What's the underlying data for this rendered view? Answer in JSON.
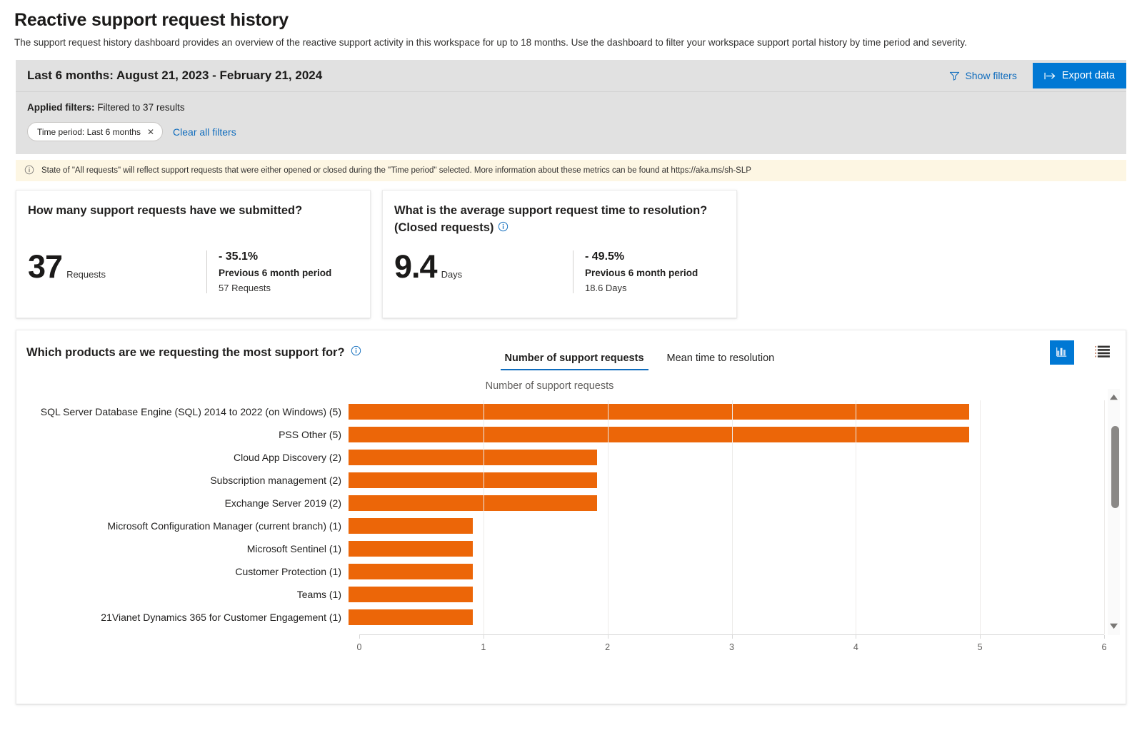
{
  "header": {
    "title": "Reactive support request history",
    "description": "The support request history dashboard provides an overview of the reactive support activity in this workspace for up to 18 months. Use the dashboard to filter your workspace support portal history by time period and severity."
  },
  "filters": {
    "range_label": "Last 6 months: August 21, 2023 - February 21, 2024",
    "show_filters_label": "Show filters",
    "export_label": "Export data",
    "applied_label": "Applied filters:",
    "applied_summary": "Filtered to 37 results",
    "chips": [
      {
        "label": "Time period: Last 6 months",
        "close": "✕"
      }
    ],
    "clear_all_label": "Clear all filters"
  },
  "banner": {
    "text": "State of \"All requests\" will reflect support requests that were either opened or closed during the \"Time period\" selected. More information about these metrics can be found at https://aka.ms/sh-SLP"
  },
  "kpis": [
    {
      "question": "How many support requests have we submitted?",
      "question_sub": "",
      "has_info": false,
      "value": "37",
      "unit": "Requests",
      "delta": "- 35.1%",
      "previous_label": "Previous 6 month period",
      "previous_value": "57 Requests"
    },
    {
      "question": "What is the average support request time to resolution?",
      "question_sub": "(Closed requests)",
      "has_info": true,
      "value": "9.4",
      "unit": "Days",
      "delta": "- 49.5%",
      "previous_label": "Previous 6 month period",
      "previous_value": "18.6 Days"
    }
  ],
  "chart_panel": {
    "question": "Which products are we requesting the most support for?",
    "tabs": [
      {
        "label": "Number of support requests",
        "active": true
      },
      {
        "label": "Mean time to resolution",
        "active": false
      }
    ],
    "view_buttons": [
      {
        "icon": "bar-chart-icon",
        "active": true
      },
      {
        "icon": "details-list-icon",
        "active": false
      }
    ]
  },
  "chart_data": {
    "type": "bar",
    "orientation": "horizontal",
    "title": "Number of support requests",
    "xlabel": "",
    "ylabel": "",
    "xlim": [
      0,
      6
    ],
    "xticks": [
      0,
      1,
      2,
      3,
      4,
      5,
      6
    ],
    "grid": true,
    "legend": "none",
    "bar_color": "#ec6608",
    "categories": [
      "SQL Server  Database Engine (SQL)  2014 to 2022 (on Windows) (5)",
      "PSS Other (5)",
      "Cloud App Discovery (2)",
      "Subscription management (2)",
      "Exchange Server 2019 (2)",
      "Microsoft Configuration Manager (current branch) (1)",
      "Microsoft Sentinel (1)",
      "Customer Protection (1)",
      "Teams (1)",
      "21Vianet Dynamics 365 for Customer Engagement (1)"
    ],
    "values": [
      5,
      5,
      2,
      2,
      2,
      1,
      1,
      1,
      1,
      1
    ]
  }
}
